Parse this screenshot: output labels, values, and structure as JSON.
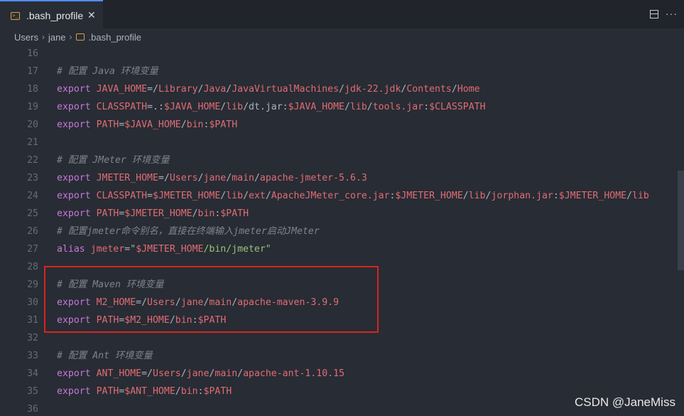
{
  "tab": {
    "label": ".bash_profile",
    "close": "✕",
    "icon": "terminal-file-icon"
  },
  "breadcrumb": {
    "items": [
      "Users",
      "jane",
      ".bash_profile"
    ],
    "sep": "›"
  },
  "more": "···",
  "watermark": "CSDN @JaneMiss",
  "colors": {
    "keyword": "#c678dd",
    "variable": "#e06c75",
    "string": "#98c379",
    "comment": "#7f848e",
    "highlight": "#d8241f"
  },
  "lines": [
    {
      "n": "16",
      "tokens": []
    },
    {
      "n": "17",
      "tokens": [
        {
          "c": "comment",
          "t": "# 配置 Java 环境变量"
        }
      ]
    },
    {
      "n": "18",
      "tokens": [
        {
          "c": "kw",
          "t": "export "
        },
        {
          "c": "var",
          "t": "JAVA_HOME"
        },
        {
          "c": "op",
          "t": "=/"
        },
        {
          "c": "var",
          "t": "Library"
        },
        {
          "c": "op",
          "t": "/"
        },
        {
          "c": "var",
          "t": "Java"
        },
        {
          "c": "op",
          "t": "/"
        },
        {
          "c": "var",
          "t": "JavaVirtualMachines"
        },
        {
          "c": "op",
          "t": "/"
        },
        {
          "c": "var",
          "t": "jdk-22.jdk"
        },
        {
          "c": "op",
          "t": "/"
        },
        {
          "c": "var",
          "t": "Contents"
        },
        {
          "c": "op",
          "t": "/"
        },
        {
          "c": "var",
          "t": "Home"
        }
      ]
    },
    {
      "n": "19",
      "tokens": [
        {
          "c": "kw",
          "t": "export "
        },
        {
          "c": "var",
          "t": "CLASSPATH"
        },
        {
          "c": "op",
          "t": "=.:"
        },
        {
          "c": "var",
          "t": "$JAVA_HOME"
        },
        {
          "c": "op",
          "t": "/"
        },
        {
          "c": "var",
          "t": "lib"
        },
        {
          "c": "op",
          "t": "/dt.jar:"
        },
        {
          "c": "var",
          "t": "$JAVA_HOME"
        },
        {
          "c": "op",
          "t": "/"
        },
        {
          "c": "var",
          "t": "lib"
        },
        {
          "c": "op",
          "t": "/"
        },
        {
          "c": "var",
          "t": "tools.jar"
        },
        {
          "c": "op",
          "t": ":"
        },
        {
          "c": "var",
          "t": "$CLASSPATH"
        }
      ]
    },
    {
      "n": "20",
      "tokens": [
        {
          "c": "kw",
          "t": "export "
        },
        {
          "c": "var",
          "t": "PATH"
        },
        {
          "c": "op",
          "t": "="
        },
        {
          "c": "var",
          "t": "$JAVA_HOME"
        },
        {
          "c": "op",
          "t": "/"
        },
        {
          "c": "var",
          "t": "bin"
        },
        {
          "c": "op",
          "t": ":"
        },
        {
          "c": "var",
          "t": "$PATH"
        }
      ]
    },
    {
      "n": "21",
      "tokens": []
    },
    {
      "n": "22",
      "tokens": [
        {
          "c": "comment",
          "t": "# 配置 JMeter 环境变量"
        }
      ]
    },
    {
      "n": "23",
      "tokens": [
        {
          "c": "kw",
          "t": "export "
        },
        {
          "c": "var",
          "t": "JMETER_HOME"
        },
        {
          "c": "op",
          "t": "=/"
        },
        {
          "c": "var",
          "t": "Users"
        },
        {
          "c": "op",
          "t": "/"
        },
        {
          "c": "var",
          "t": "jane"
        },
        {
          "c": "op",
          "t": "/"
        },
        {
          "c": "var",
          "t": "main"
        },
        {
          "c": "op",
          "t": "/"
        },
        {
          "c": "var",
          "t": "apache-jmeter-5.6.3"
        }
      ]
    },
    {
      "n": "24",
      "tokens": [
        {
          "c": "kw",
          "t": "export "
        },
        {
          "c": "var",
          "t": "CLASSPATH"
        },
        {
          "c": "op",
          "t": "="
        },
        {
          "c": "var",
          "t": "$JMETER_HOME"
        },
        {
          "c": "op",
          "t": "/"
        },
        {
          "c": "var",
          "t": "lib"
        },
        {
          "c": "op",
          "t": "/"
        },
        {
          "c": "var",
          "t": "ext"
        },
        {
          "c": "op",
          "t": "/"
        },
        {
          "c": "var",
          "t": "ApacheJMeter_core.jar"
        },
        {
          "c": "op",
          "t": ":"
        },
        {
          "c": "var",
          "t": "$JMETER_HOME"
        },
        {
          "c": "op",
          "t": "/"
        },
        {
          "c": "var",
          "t": "lib"
        },
        {
          "c": "op",
          "t": "/"
        },
        {
          "c": "var",
          "t": "jorphan.jar"
        },
        {
          "c": "op",
          "t": ":"
        },
        {
          "c": "var",
          "t": "$JMETER_HOME"
        },
        {
          "c": "op",
          "t": "/"
        },
        {
          "c": "var",
          "t": "lib"
        }
      ]
    },
    {
      "n": "25",
      "tokens": [
        {
          "c": "kw",
          "t": "export "
        },
        {
          "c": "var",
          "t": "PATH"
        },
        {
          "c": "op",
          "t": "="
        },
        {
          "c": "var",
          "t": "$JMETER_HOME"
        },
        {
          "c": "op",
          "t": "/"
        },
        {
          "c": "var",
          "t": "bin"
        },
        {
          "c": "op",
          "t": ":"
        },
        {
          "c": "var",
          "t": "$PATH"
        }
      ]
    },
    {
      "n": "26",
      "tokens": [
        {
          "c": "comment",
          "t": "# 配置jmeter命令别名，直接在终端输入jmeter启动JMeter"
        }
      ]
    },
    {
      "n": "27",
      "tokens": [
        {
          "c": "kw",
          "t": "alias "
        },
        {
          "c": "var",
          "t": "jmeter"
        },
        {
          "c": "op",
          "t": "="
        },
        {
          "c": "str",
          "t": "\""
        },
        {
          "c": "var",
          "t": "$JMETER_HOME"
        },
        {
          "c": "str",
          "t": "/bin/jmeter\""
        }
      ]
    },
    {
      "n": "28",
      "tokens": []
    },
    {
      "n": "29",
      "tokens": [
        {
          "c": "comment",
          "t": "# 配置 Maven 环境变量"
        }
      ]
    },
    {
      "n": "30",
      "tokens": [
        {
          "c": "kw",
          "t": "export "
        },
        {
          "c": "var",
          "t": "M2_HOME"
        },
        {
          "c": "op",
          "t": "=/"
        },
        {
          "c": "var",
          "t": "Users"
        },
        {
          "c": "op",
          "t": "/"
        },
        {
          "c": "var",
          "t": "jane"
        },
        {
          "c": "op",
          "t": "/"
        },
        {
          "c": "var",
          "t": "main"
        },
        {
          "c": "op",
          "t": "/"
        },
        {
          "c": "var",
          "t": "apache-maven-3.9.9"
        }
      ]
    },
    {
      "n": "31",
      "tokens": [
        {
          "c": "kw",
          "t": "export "
        },
        {
          "c": "var",
          "t": "PATH"
        },
        {
          "c": "op",
          "t": "="
        },
        {
          "c": "var",
          "t": "$M2_HOME"
        },
        {
          "c": "op",
          "t": "/"
        },
        {
          "c": "var",
          "t": "bin"
        },
        {
          "c": "op",
          "t": ":"
        },
        {
          "c": "var",
          "t": "$PATH"
        }
      ]
    },
    {
      "n": "32",
      "tokens": []
    },
    {
      "n": "33",
      "tokens": [
        {
          "c": "comment",
          "t": "# 配置 Ant 环境变量"
        }
      ]
    },
    {
      "n": "34",
      "tokens": [
        {
          "c": "kw",
          "t": "export "
        },
        {
          "c": "var",
          "t": "ANT_HOME"
        },
        {
          "c": "op",
          "t": "=/"
        },
        {
          "c": "var",
          "t": "Users"
        },
        {
          "c": "op",
          "t": "/"
        },
        {
          "c": "var",
          "t": "jane"
        },
        {
          "c": "op",
          "t": "/"
        },
        {
          "c": "var",
          "t": "main"
        },
        {
          "c": "op",
          "t": "/"
        },
        {
          "c": "var",
          "t": "apache-ant-1.10.15"
        }
      ]
    },
    {
      "n": "35",
      "tokens": [
        {
          "c": "kw",
          "t": "export "
        },
        {
          "c": "var",
          "t": "PATH"
        },
        {
          "c": "op",
          "t": "="
        },
        {
          "c": "var",
          "t": "$ANT_HOME"
        },
        {
          "c": "op",
          "t": "/"
        },
        {
          "c": "var",
          "t": "bin"
        },
        {
          "c": "op",
          "t": ":"
        },
        {
          "c": "var",
          "t": "$PATH"
        }
      ]
    },
    {
      "n": "36",
      "tokens": []
    }
  ]
}
